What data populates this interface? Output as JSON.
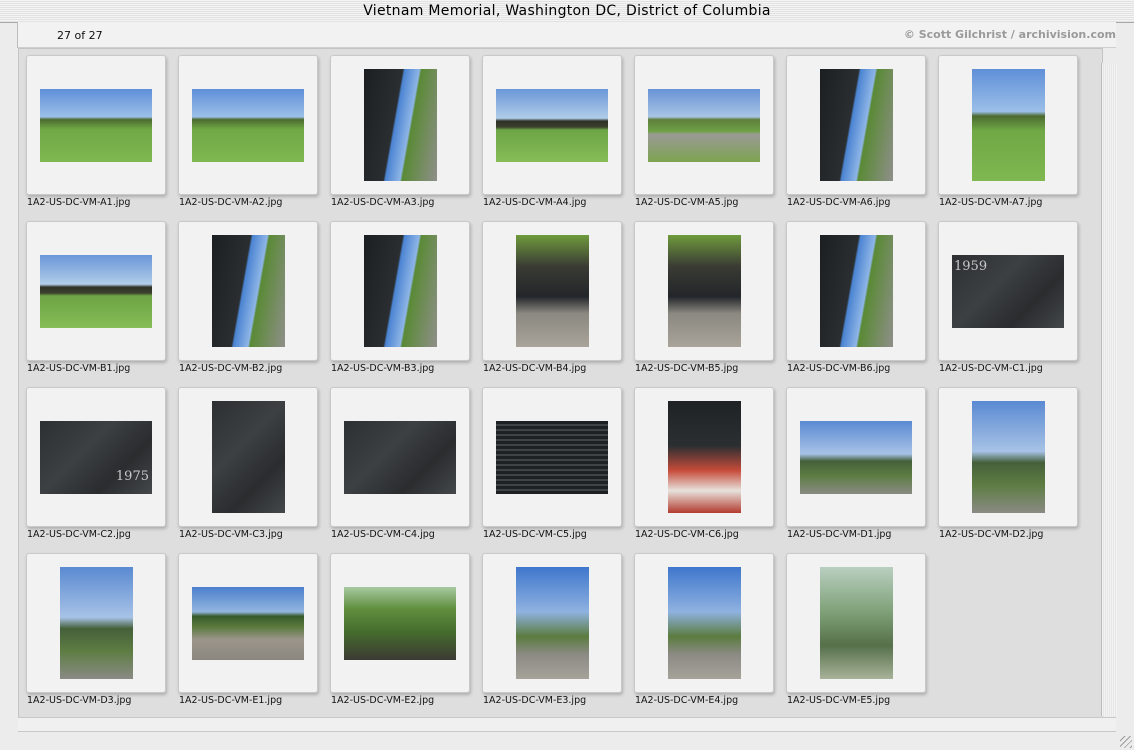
{
  "window": {
    "title": "Vietnam Memorial, Washington DC, District of Columbia"
  },
  "header": {
    "counter": "27 of 27",
    "credit": "© Scott Gilchrist / archivision.com"
  },
  "images": [
    {
      "filename": "1A2-US-DC-VM-A1.jpg",
      "orientation": "landscape",
      "scene": "lawn"
    },
    {
      "filename": "1A2-US-DC-VM-A2.jpg",
      "orientation": "landscape",
      "scene": "lawn"
    },
    {
      "filename": "1A2-US-DC-VM-A3.jpg",
      "orientation": "portrait",
      "scene": "wall-walk"
    },
    {
      "filename": "1A2-US-DC-VM-A4.jpg",
      "orientation": "landscape",
      "scene": "lawn-wall"
    },
    {
      "filename": "1A2-US-DC-VM-A5.jpg",
      "orientation": "landscape",
      "scene": "path"
    },
    {
      "filename": "1A2-US-DC-VM-A6.jpg",
      "orientation": "portrait",
      "scene": "wall-walk"
    },
    {
      "filename": "1A2-US-DC-VM-A7.jpg",
      "orientation": "portrait",
      "scene": "lawn"
    },
    {
      "filename": "1A2-US-DC-VM-B1.jpg",
      "orientation": "landscape",
      "scene": "lawn-wall"
    },
    {
      "filename": "1A2-US-DC-VM-B2.jpg",
      "orientation": "portrait",
      "scene": "wall-walk"
    },
    {
      "filename": "1A2-US-DC-VM-B3.jpg",
      "orientation": "portrait",
      "scene": "wall-walk"
    },
    {
      "filename": "1A2-US-DC-VM-B4.jpg",
      "orientation": "portrait",
      "scene": "crowd"
    },
    {
      "filename": "1A2-US-DC-VM-B5.jpg",
      "orientation": "portrait",
      "scene": "crowd"
    },
    {
      "filename": "1A2-US-DC-VM-B6.jpg",
      "orientation": "portrait",
      "scene": "wall-walk"
    },
    {
      "filename": "1A2-US-DC-VM-C1.jpg",
      "orientation": "landscape",
      "scene": "names",
      "overlay": "1959"
    },
    {
      "filename": "1A2-US-DC-VM-C2.jpg",
      "orientation": "landscape",
      "scene": "names",
      "overlay": "1975"
    },
    {
      "filename": "1A2-US-DC-VM-C3.jpg",
      "orientation": "portrait",
      "scene": "names"
    },
    {
      "filename": "1A2-US-DC-VM-C4.jpg",
      "orientation": "landscape",
      "scene": "names"
    },
    {
      "filename": "1A2-US-DC-VM-C5.jpg",
      "orientation": "landscape",
      "scene": "names-close"
    },
    {
      "filename": "1A2-US-DC-VM-C6.jpg",
      "orientation": "portrait",
      "scene": "visitors"
    },
    {
      "filename": "1A2-US-DC-VM-D1.jpg",
      "orientation": "landscape",
      "scene": "statue-park"
    },
    {
      "filename": "1A2-US-DC-VM-D2.jpg",
      "orientation": "portrait",
      "scene": "statue-park"
    },
    {
      "filename": "1A2-US-DC-VM-D3.jpg",
      "orientation": "portrait",
      "scene": "statue-park"
    },
    {
      "filename": "1A2-US-DC-VM-E1.jpg",
      "orientation": "landscape",
      "scene": "statue-plaza"
    },
    {
      "filename": "1A2-US-DC-VM-E2.jpg",
      "orientation": "landscape",
      "scene": "statue-green"
    },
    {
      "filename": "1A2-US-DC-VM-E3.jpg",
      "orientation": "portrait",
      "scene": "statue-sky"
    },
    {
      "filename": "1A2-US-DC-VM-E4.jpg",
      "orientation": "portrait",
      "scene": "statue-sky"
    },
    {
      "filename": "1A2-US-DC-VM-E5.jpg",
      "orientation": "portrait",
      "scene": "statue-close"
    }
  ],
  "colors": {
    "window_bg": "#ececec",
    "content_bg": "#dedede",
    "card_bg": "#f2f2f2",
    "credit": "#9a9a9a"
  }
}
